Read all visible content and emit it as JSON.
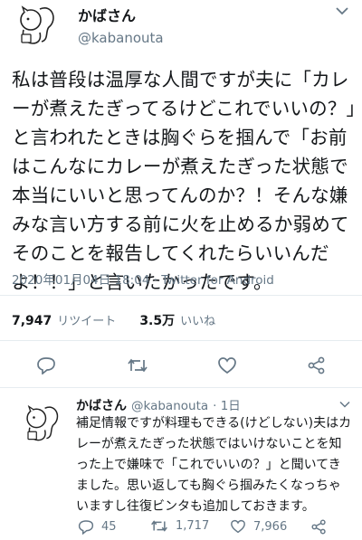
{
  "tweet": {
    "name": "かばさん",
    "handle": "@kabanouta",
    "text": "私は普段は温厚な人間ですが夫に「カレーが煮えたぎってるけどこれでいいの？」と言われたときは胸ぐらを掴んで「お前はこんなにカレーが煮えたぎった状態で本当にいいと思ってんのか？！そんな嫌みな言い方する前に火を止めるか弱めてそのことを報告してくれたらいいんだよ！！」と言いたかったです。",
    "timestamp": "2020年01月04日 18:04 · Twitter for Android",
    "retweets": "7,947",
    "retweets_label": "リツイート",
    "likes": "3.5万",
    "likes_label": "いいね"
  },
  "reply": {
    "name": "かばさん",
    "handle": "@kabanouta",
    "age": "· 1日",
    "text": "補足情報ですが料理もできる(けどしない)夫はカレーが煮えたぎった状態ではいけないことを知った上で嫌味で「これでいいの？」と聞いてきました。思い返しても胸ぐら掴みたくなっちゃいますし往復ビンタも追加しておきます。",
    "replies": "45",
    "retweets": "1,717",
    "likes": "7,966"
  },
  "colors": {
    "text": "#14171a",
    "muted": "#657786",
    "divider": "#e6ecf0"
  },
  "icons": [
    "chevron-down-icon",
    "reply-icon",
    "retweet-icon",
    "like-icon",
    "share-icon",
    "avatar-squirrel-icon"
  ]
}
